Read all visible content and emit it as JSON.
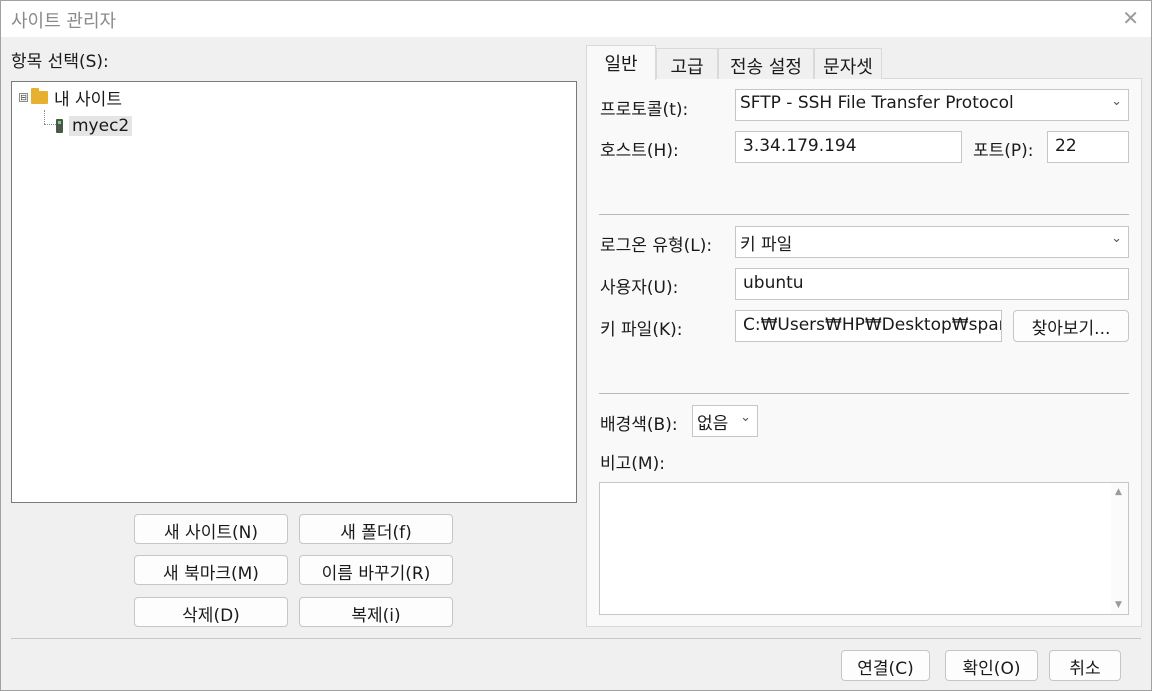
{
  "window": {
    "title": "사이트 관리자",
    "close_glyph": "✕"
  },
  "left": {
    "select_label": "항목 선택(S):",
    "tree": {
      "root_label": "내 사이트",
      "root_expander": "⊟",
      "child_label": "myec2"
    },
    "buttons": {
      "new_site": "새 사이트(N)",
      "new_folder": "새 폴더(f)",
      "new_bookmark": "새 북마크(M)",
      "rename": "이름 바꾸기(R)",
      "delete": "삭제(D)",
      "duplicate": "복제(i)"
    }
  },
  "tabs": [
    {
      "label": "일반",
      "active": true
    },
    {
      "label": "고급",
      "active": false
    },
    {
      "label": "전송 설정",
      "active": false
    },
    {
      "label": "문자셋",
      "active": false
    }
  ],
  "general": {
    "protocol_label": "프로토콜(t):",
    "protocol_value": "SFTP - SSH File Transfer Protocol",
    "host_label": "호스트(H):",
    "host_value": "3.34.179.194",
    "port_label": "포트(P):",
    "port_value": "22",
    "logon_label": "로그온 유형(L):",
    "logon_value": "키 파일",
    "user_label": "사용자(U):",
    "user_value": "ubuntu",
    "keyfile_label": "키 파일(K):",
    "keyfile_value": "C:₩Users₩HP₩Desktop₩spart",
    "browse_button": "찾아보기...",
    "bgcolor_label": "배경색(B):",
    "bgcolor_value": "없음",
    "comment_label": "비고(M):",
    "comment_value": ""
  },
  "footer": {
    "connect": "연결(C)",
    "ok": "확인(O)",
    "cancel": "취소"
  },
  "icons": {
    "chevron": "⌄",
    "scroll_up": "▲",
    "scroll_down": "▼"
  }
}
